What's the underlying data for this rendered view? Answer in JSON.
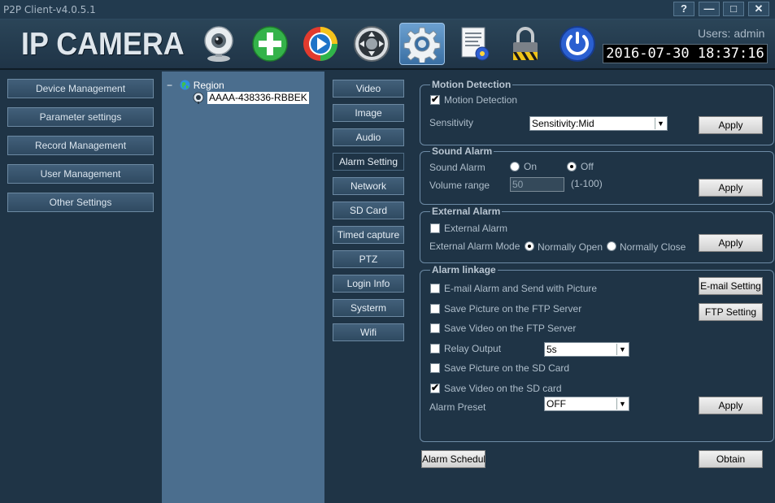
{
  "window": {
    "title": "P2P Client-v4.0.5.1",
    "help": "?",
    "minimize": "—",
    "maximize": "□",
    "close": "✕"
  },
  "header": {
    "brand": "IP CAMERA",
    "users": "Users: admin",
    "datetime": "2016-07-30 18:37:16",
    "toolbar_icons": [
      "webcam-icon",
      "add-icon",
      "play-icon",
      "ptz-icon",
      "settings-icon",
      "log-icon",
      "lock-icon",
      "power-icon"
    ]
  },
  "left_menu": {
    "items": [
      "Device Management",
      "Parameter settings",
      "Record Management",
      "User Management",
      "Other Settings"
    ]
  },
  "tree": {
    "root": "Region",
    "device": "AAAA-438336-RBBEK"
  },
  "tabs": [
    "Video",
    "Image",
    "Audio",
    "Alarm Setting",
    "Network",
    "SD Card",
    "Timed capture",
    "PTZ",
    "Login Info",
    "Systerm",
    "Wifi"
  ],
  "motion": {
    "title": "Motion Detection",
    "checkbox_label": "Motion Detection",
    "checked": true,
    "sensitivity_label": "Sensitivity",
    "sensitivity_value": "Sensitivity:Mid",
    "apply": "Apply"
  },
  "sound": {
    "title": "Sound Alarm",
    "label": "Sound Alarm",
    "on": "On",
    "off": "Off",
    "selected": "Off",
    "volume_label": "Volume range",
    "volume_value": "50",
    "volume_hint": "(1-100)",
    "apply": "Apply"
  },
  "external": {
    "title": "External Alarm",
    "checkbox_label": "External Alarm",
    "checked": false,
    "mode_label": "External Alarm Mode",
    "open": "Normally Open",
    "close": "Normally Close",
    "selected": "Normally Open",
    "apply": "Apply"
  },
  "linkage": {
    "title": "Alarm linkage",
    "email": "E-mail Alarm and Send with Picture",
    "ftp_picture": "Save Picture on the FTP Server",
    "ftp_video": "Save Video on the FTP Server",
    "relay": "Relay Output",
    "relay_value": "5s",
    "sd_picture": "Save Picture on the SD Card",
    "sd_video": "Save Video on the SD card",
    "preset_label": "Alarm Preset",
    "preset_value": "OFF",
    "email_setting": "E-mail Setting",
    "ftp_setting": "FTP Setting",
    "apply": "Apply",
    "checked": {
      "email": false,
      "ftp_picture": false,
      "ftp_video": false,
      "relay": false,
      "sd_picture": false,
      "sd_video": true
    }
  },
  "footer": {
    "schedule": "Alarm Schedule",
    "obtain": "Obtain"
  }
}
